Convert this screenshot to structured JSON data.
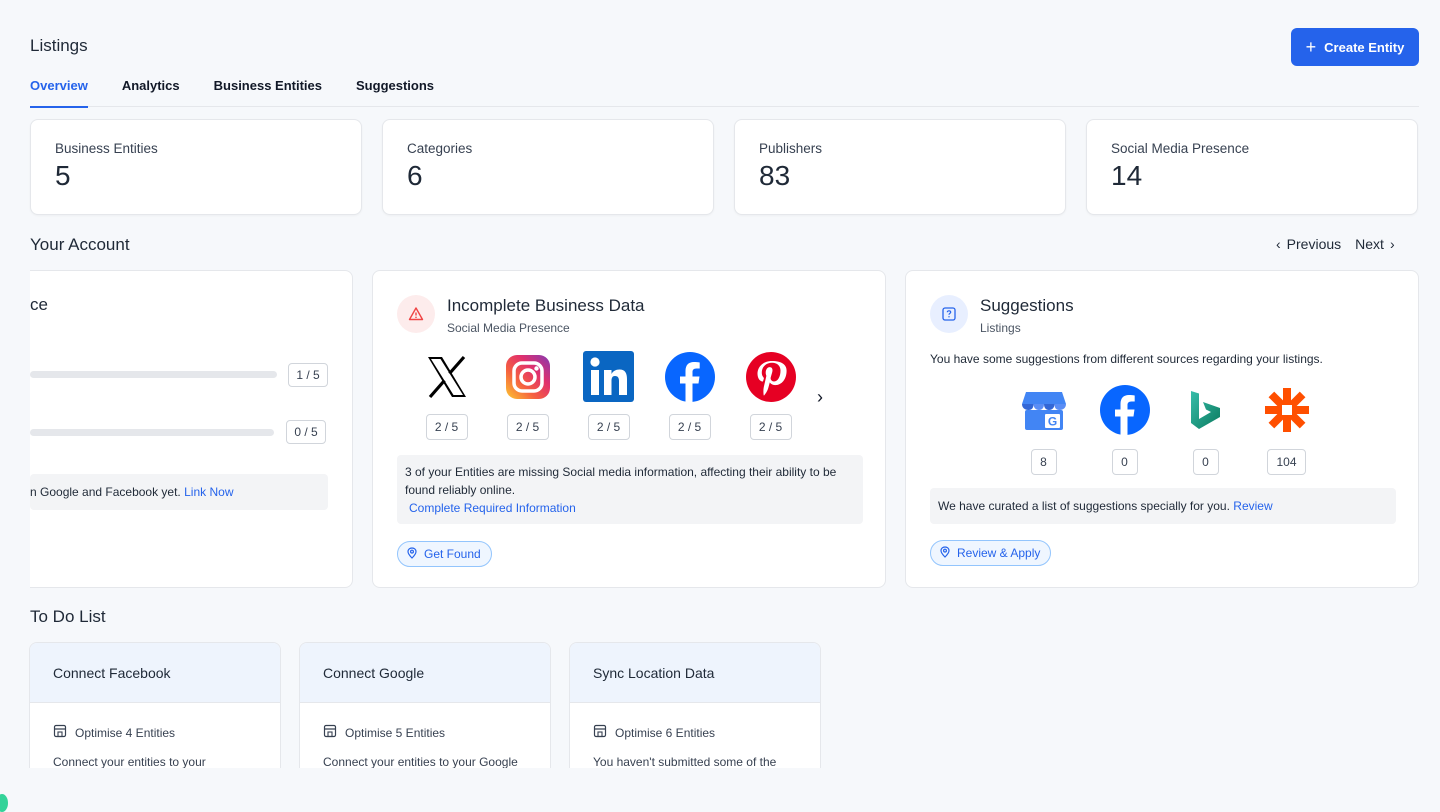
{
  "header": {
    "title": "Listings",
    "create_button": "Create Entity"
  },
  "tabs": [
    "Overview",
    "Analytics",
    "Business Entities",
    "Suggestions"
  ],
  "stats": [
    {
      "label": "Business Entities",
      "value": "5"
    },
    {
      "label": "Categories",
      "value": "6"
    },
    {
      "label": "Publishers",
      "value": "83"
    },
    {
      "label": "Social Media Presence",
      "value": "14"
    }
  ],
  "account": {
    "title": "Your Account",
    "previous": "Previous",
    "next": "Next",
    "card1": {
      "title_fragment": "ce",
      "badge1": "1 / 5",
      "badge2": "0 / 5",
      "note_text": "n Google and Facebook yet.",
      "note_link": "Link Now"
    },
    "card2": {
      "title": "Incomplete Business Data",
      "subtitle": "Social Media Presence",
      "socials": [
        {
          "icon": "x-logo-icon",
          "count": "2 / 5"
        },
        {
          "icon": "instagram-logo-icon",
          "count": "2 / 5"
        },
        {
          "icon": "linkedin-logo-icon",
          "count": "2 / 5"
        },
        {
          "icon": "facebook-logo-icon",
          "count": "2 / 5"
        },
        {
          "icon": "pinterest-logo-icon",
          "count": "2 / 5"
        }
      ],
      "info_text": "3 of your Entities are missing Social media information, affecting their ability to be found reliably online.",
      "info_link": "Complete Required Information",
      "action": "Get Found"
    },
    "card3": {
      "title": "Suggestions",
      "subtitle": "Listings",
      "text": "You have some suggestions from different sources regarding your listings.",
      "sources": [
        {
          "icon": "google-business-logo-icon",
          "count": "8"
        },
        {
          "icon": "facebook-logo-icon",
          "count": "0"
        },
        {
          "icon": "bing-logo-icon",
          "count": "0"
        },
        {
          "icon": "zapier-logo-icon",
          "count": "104"
        }
      ],
      "info_text": "We have curated a list of suggestions specially for you.",
      "info_link": "Review",
      "action": "Review & Apply"
    }
  },
  "todo": {
    "title": "To Do List",
    "items": [
      {
        "title": "Connect Facebook",
        "meta": "Optimise 4 Entities",
        "desc": "Connect your entities to your"
      },
      {
        "title": "Connect Google",
        "meta": "Optimise 5 Entities",
        "desc": "Connect your entities to your Google"
      },
      {
        "title": "Sync Location Data",
        "meta": "Optimise 6 Entities",
        "desc": "You haven't submitted some of the"
      }
    ]
  },
  "colors": {
    "accent": "#2563eb",
    "todo_header": "#eef4fd"
  }
}
